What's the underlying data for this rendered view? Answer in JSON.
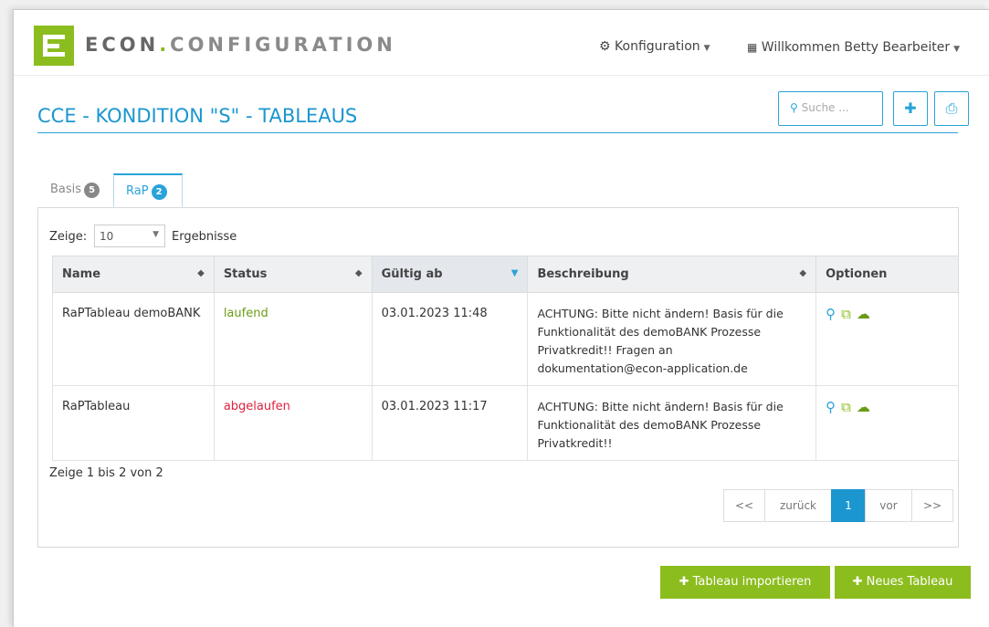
{
  "header": {
    "brand_main": "ECON",
    "brand_dot": ".",
    "brand_sub": "CONFIGURATION",
    "config_menu": "Konfiguration",
    "user_menu": "Willkommen Betty Bearbeiter"
  },
  "page": {
    "title": "CCE - KONDITION \"S\" - TABLEAUS",
    "search_placeholder": "Suche ..."
  },
  "tabs": [
    {
      "label": "Basis",
      "count": "5"
    },
    {
      "label": "RaP",
      "count": "2"
    }
  ],
  "length_control": {
    "prefix": "Zeige:",
    "value": "10",
    "suffix": "Ergebnisse"
  },
  "table": {
    "columns": [
      "Name",
      "Status",
      "Gültig ab",
      "Beschreibung",
      "Optionen"
    ],
    "rows": [
      {
        "name": "RaPTableau demoBANK",
        "status": "laufend",
        "valid_from": "03.01.2023 11:48",
        "description_lines": [
          "ACHTUNG: Bitte nicht ändern! Basis für die",
          "Funktionalität des demoBANK Prozesse",
          "Privatkredit!! Fragen an",
          "dokumentation@econ-application.de"
        ]
      },
      {
        "name": "RaPTableau",
        "status": "abgelaufen",
        "valid_from": "03.01.2023 11:17",
        "description_lines": [
          "ACHTUNG: Bitte nicht ändern! Basis für die",
          "Funktionalität des demoBANK Prozesse",
          "Privatkredit!!"
        ]
      }
    ],
    "info": "Zeige 1 bis 2 von 2"
  },
  "pagination": {
    "first": "<<",
    "prev": "zurück",
    "current": "1",
    "next": "vor",
    "last": ">>"
  },
  "actions": {
    "import": "Tableau importieren",
    "new": "Neues Tableau"
  },
  "icons": {
    "config": "gear-icon",
    "user": "grid-icon",
    "search": "search-icon",
    "add": "plus-icon",
    "print": "print-icon",
    "row_view": "search-icon",
    "row_copy": "copy-icon",
    "row_download": "cloud-download-icon"
  },
  "colors": {
    "brand_green": "#8cbd1e",
    "accent_blue": "#1b96cf",
    "status_running": "#6a9b17",
    "status_expired": "#e0223f"
  }
}
